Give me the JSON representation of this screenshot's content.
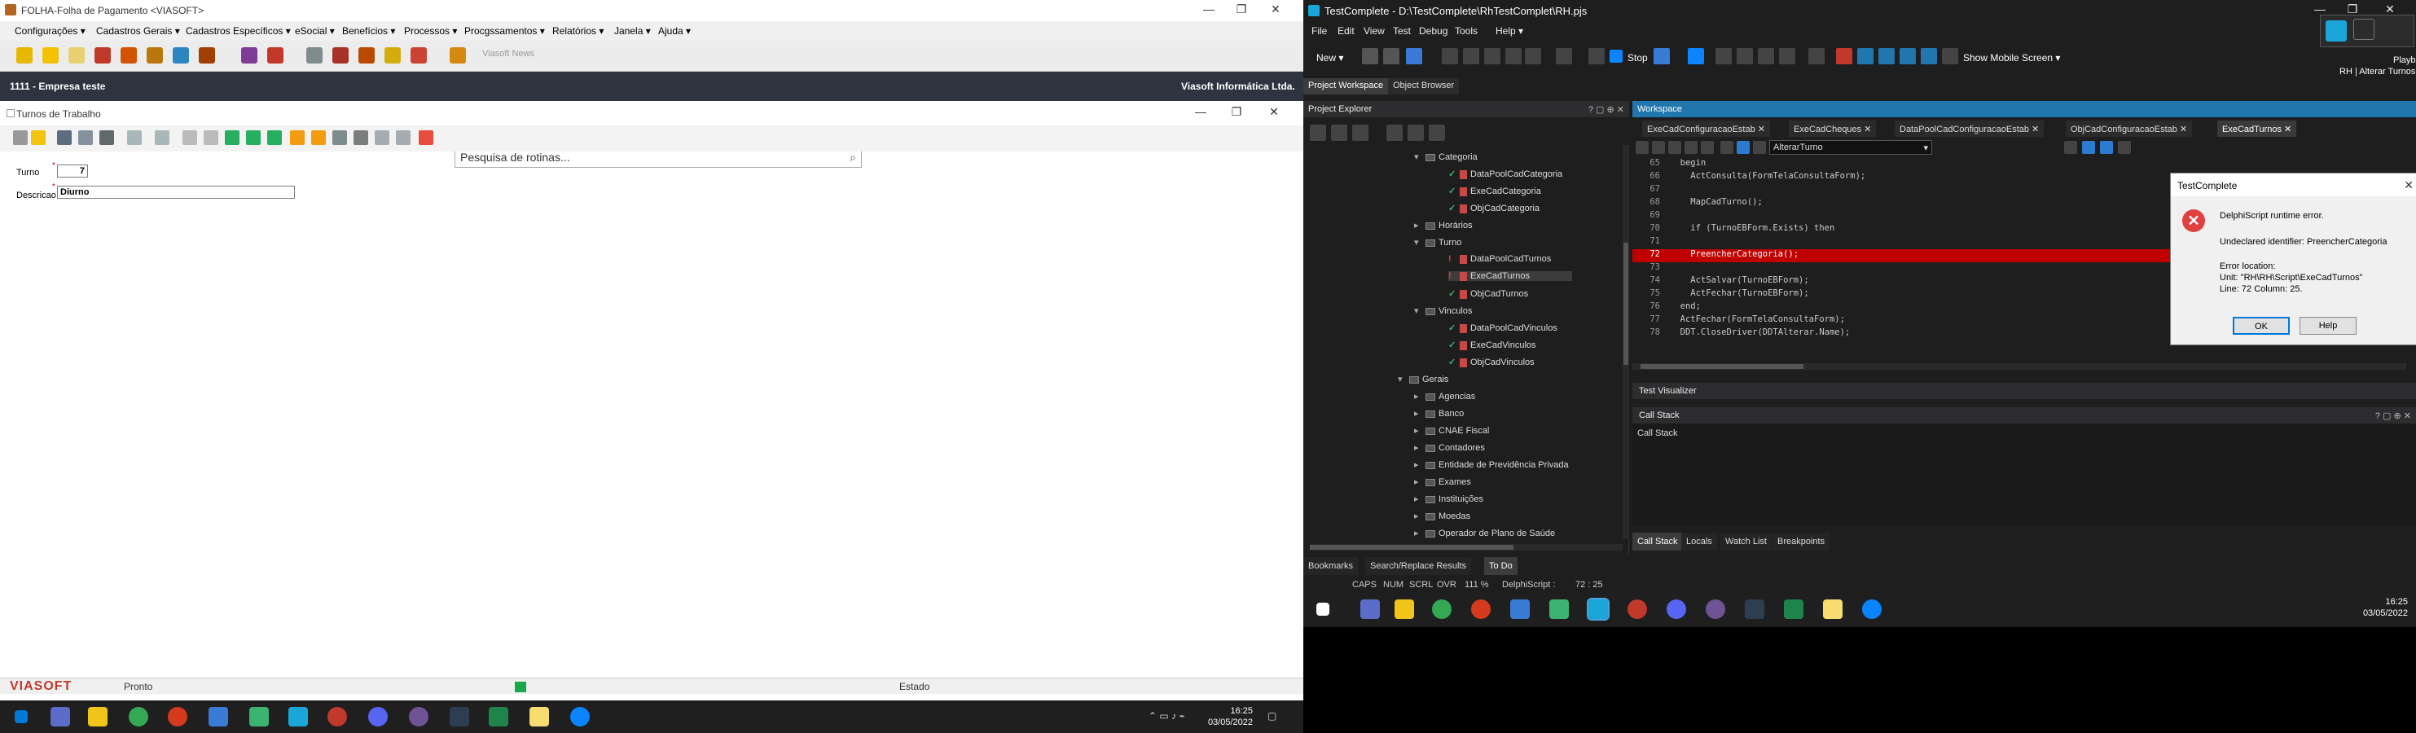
{
  "left": {
    "window_title": "FOLHA-Folha de Pagamento <VIASOFT>",
    "menu": [
      "Configurações",
      "Cadastros Gerais",
      "Cadastros Específicos",
      "eSocial",
      "Benefícios",
      "Processos",
      "Procgssamentos",
      "Relatórios",
      "Janela",
      "Ajuda"
    ],
    "news_label": "Viasoft News",
    "company": "1111 - Empresa teste",
    "vendor": "Viasoft Informática Ltda.",
    "search_placeholder": "Pesquisa de rotinas...",
    "subwindow_title": "Turnos de Trabalho",
    "form": {
      "turno_label": "Turno",
      "turno_value": "7",
      "descricao_label": "Descricao",
      "descricao_value": "Diurno"
    },
    "status": {
      "logo": "VIASOFT",
      "ready": "Pronto",
      "estado": "Estado"
    },
    "clock": {
      "time": "16:25",
      "date": "03/05/2022"
    }
  },
  "right": {
    "window_title": "TestComplete - D:\\TestComplete\\RhTestComplet\\RH.pjs",
    "menu": [
      "File",
      "Edit",
      "View",
      "Test",
      "Debug",
      "Tools",
      "Help"
    ],
    "toolbar": {
      "new_label": "New",
      "stop_label": "Stop",
      "mobile_label": "Show Mobile Screen"
    },
    "playback": {
      "title": "Playback",
      "subtitle": "RH | Alterar Turnos"
    },
    "top_tabs": [
      "Project Workspace",
      "Object Browser"
    ],
    "explorer_title": "Project Explorer",
    "tree": [
      {
        "label": "Categoria",
        "kind": "folder"
      },
      {
        "label": "DataPoolCadCategoria",
        "kind": "ok"
      },
      {
        "label": "ExeCadCategoria",
        "kind": "ok"
      },
      {
        "label": "ObjCadCategoria",
        "kind": "ok"
      },
      {
        "label": "Horários",
        "kind": "folder"
      },
      {
        "label": "Turno",
        "kind": "folder"
      },
      {
        "label": "DataPoolCadTurnos",
        "kind": "err"
      },
      {
        "label": "ExeCadTurnos",
        "kind": "err"
      },
      {
        "label": "ObjCadTurnos",
        "kind": "ok"
      },
      {
        "label": "Vinculos",
        "kind": "folder"
      },
      {
        "label": "DataPoolCadVinculos",
        "kind": "ok"
      },
      {
        "label": "ExeCadVinculos",
        "kind": "ok"
      },
      {
        "label": "ObjCadVinculos",
        "kind": "ok"
      },
      {
        "label": "Gerais",
        "kind": "folder"
      },
      {
        "label": "Agencias",
        "kind": "folder"
      },
      {
        "label": "Banco",
        "kind": "folder"
      },
      {
        "label": "CNAE Fiscal",
        "kind": "folder"
      },
      {
        "label": "Contadores",
        "kind": "folder"
      },
      {
        "label": "Entidade de Previdência Privada",
        "kind": "folder"
      },
      {
        "label": "Exames",
        "kind": "folder"
      },
      {
        "label": "Instituições",
        "kind": "folder"
      },
      {
        "label": "Moedas",
        "kind": "folder"
      },
      {
        "label": "Operador de Plano de Saúde",
        "kind": "folder"
      }
    ],
    "workspace_title": "Workspace",
    "ws_tabs": [
      "ExeCadConfiguracaoEstab",
      "ExeCadCheques",
      "DataPoolCadConfiguracaoEstab",
      "ObjCadConfiguracaoEstab",
      "ExeCadTurnos"
    ],
    "routine_dropdown": "AlterarTurno",
    "code": [
      {
        "ln": "65",
        "text": "  begin",
        "err": false
      },
      {
        "ln": "66",
        "text": "    ActConsulta(FormTelaConsultaForm);",
        "err": false
      },
      {
        "ln": "67",
        "text": "",
        "err": false
      },
      {
        "ln": "68",
        "text": "    MapCadTurno();",
        "err": false
      },
      {
        "ln": "69",
        "text": "",
        "err": false
      },
      {
        "ln": "70",
        "text": "    if (TurnoEBForm.Exists) then",
        "err": false
      },
      {
        "ln": "71",
        "text": "",
        "err": false
      },
      {
        "ln": "72",
        "text": "    PreencherCategoria();",
        "err": true
      },
      {
        "ln": "73",
        "text": "",
        "err": false
      },
      {
        "ln": "74",
        "text": "    ActSalvar(TurnoEBForm);",
        "err": false
      },
      {
        "ln": "75",
        "text": "    ActFechar(TurnoEBForm);",
        "err": false
      },
      {
        "ln": "76",
        "text": "  end;",
        "err": false
      },
      {
        "ln": "77",
        "text": "  ActFechar(FormTelaConsultaForm);",
        "err": false
      },
      {
        "ln": "78",
        "text": "  DDT.CloseDriver(DDTAlterar.Name);",
        "err": false
      }
    ],
    "dialog": {
      "title": "TestComplete",
      "heading": "DelphiScript runtime error.",
      "message": "Undeclared identifier: PreencherCategoria",
      "loc_label": "Error location:",
      "loc_unit": "Unit: \"RH\\RH\\Script\\ExeCadTurnos\"",
      "loc_line": "Line: 72 Column: 25.",
      "ok": "OK",
      "help": "Help"
    },
    "test_visualizer": "Test Visualizer",
    "call_stack_title": "Call Stack",
    "call_stack_body": "Call Stack",
    "cs_tabs": [
      "Call Stack",
      "Locals",
      "Watch List",
      "Breakpoints"
    ],
    "bottom_tabs": [
      "Bookmarks",
      "Search/Replace Results",
      "To Do"
    ],
    "status": {
      "caps": "CAPS",
      "num": "NUM",
      "scrl": "SCRL",
      "ovr": "OVR",
      "zoom": "111 %",
      "lang": "DelphiScript :",
      "pos": "72 : 25"
    },
    "clock": {
      "time": "16:25",
      "date": "03/05/2022"
    }
  }
}
